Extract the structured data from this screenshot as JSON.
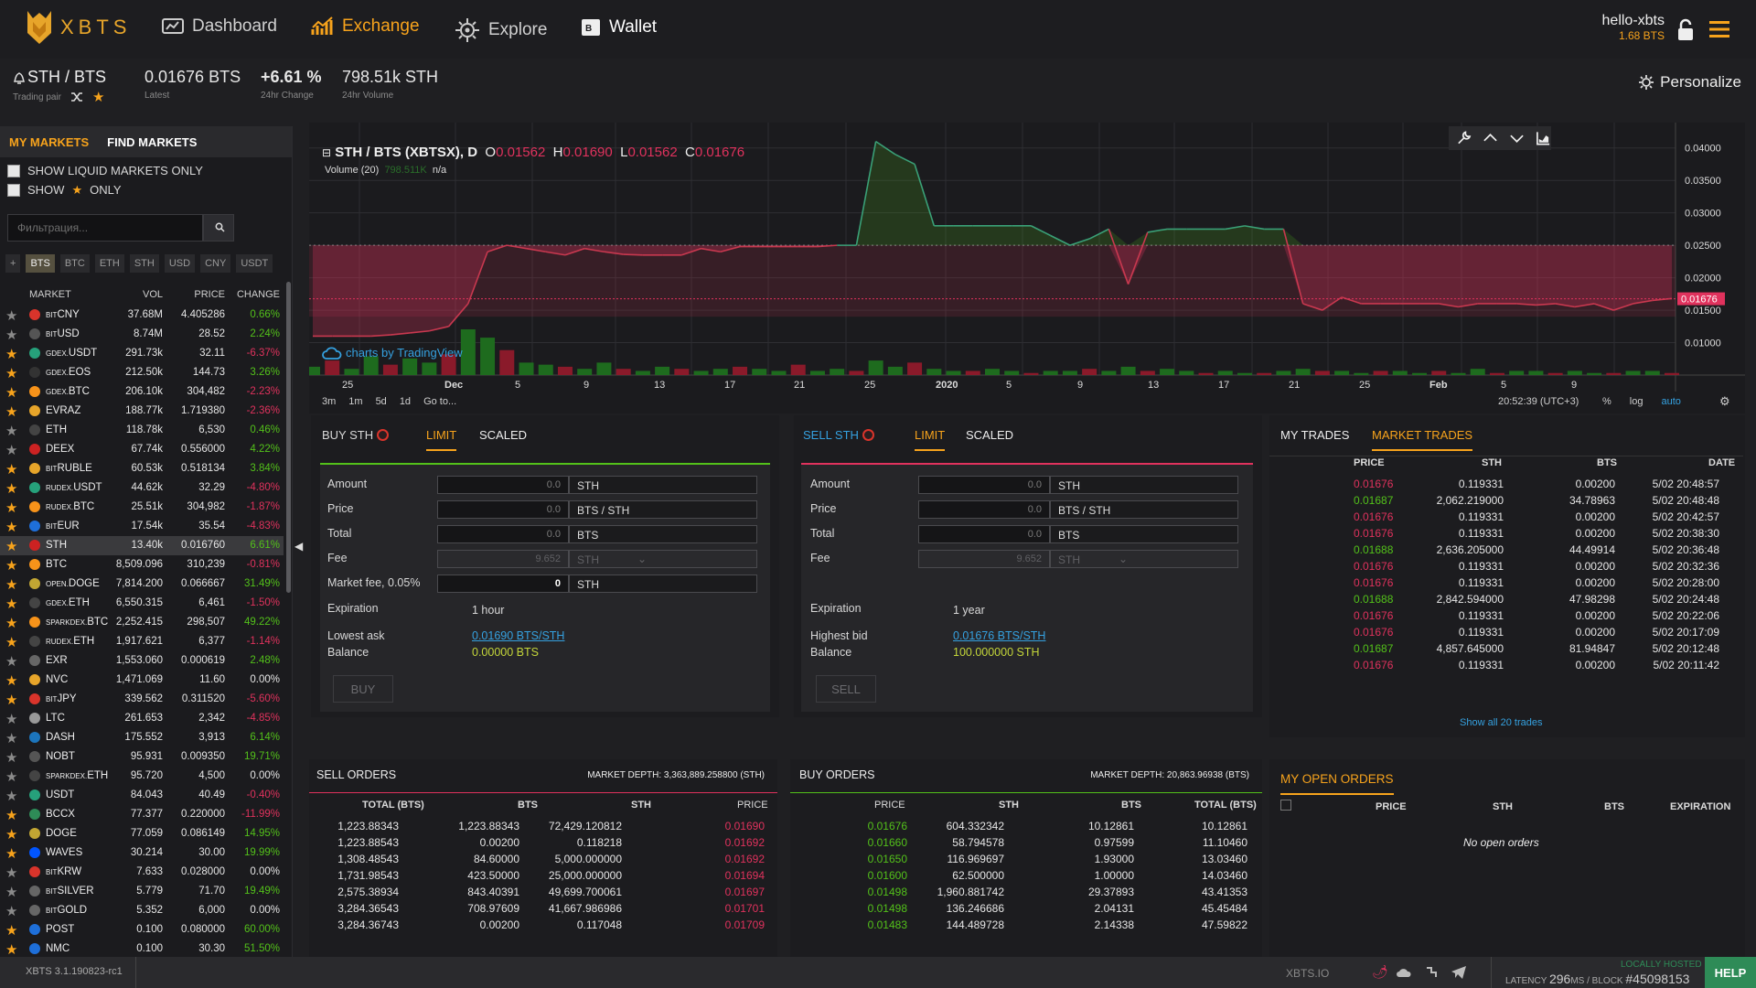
{
  "app": {
    "brand": "XBTS",
    "nav": [
      {
        "label": "Dashboard",
        "icon": "dashboard-icon"
      },
      {
        "label": "Exchange",
        "icon": "exchange-chart-icon"
      },
      {
        "label": "Explore",
        "icon": "explore-gear-icon"
      },
      {
        "label": "Wallet",
        "icon": "wallet-icon"
      }
    ],
    "user": {
      "name": "hello-xbts",
      "balance": "1.68 BTS"
    }
  },
  "pair": {
    "name": "STH / BTS",
    "caption": "Trading pair",
    "latest": "0.01676 BTS",
    "latest_label": "Latest",
    "change": "+6.61 %",
    "change_label": "24hr Change",
    "volume": "798.51k STH",
    "volume_label": "24hr Volume",
    "personalize": "Personalize"
  },
  "sidebar": {
    "tab_my": "MY MARKETS",
    "tab_find": "FIND MARKETS",
    "opt_liquid": "SHOW LIQUID MARKETS ONLY",
    "opt_star_pre": "SHOW",
    "opt_star_post": "ONLY",
    "filter_placeholder": "Фильтрация...",
    "quote_tabs": [
      "+",
      "BTS",
      "BTC",
      "ETH",
      "STH",
      "USD",
      "CNY",
      "USDT"
    ],
    "headers": {
      "market": "MARKET",
      "vol": "VOL",
      "price": "PRICE",
      "change": "CHANGE"
    },
    "markets": [
      {
        "pre": "BIT",
        "name": "CNY",
        "vol": "37.68M",
        "price": "4.405286",
        "change": "0.66%",
        "dir": "up",
        "color": "#d9342b"
      },
      {
        "pre": "BIT",
        "name": "USD",
        "vol": "8.74M",
        "price": "28.52",
        "change": "2.24%",
        "dir": "up",
        "color": "#555"
      },
      {
        "pre": "GDEX.",
        "name": "USDT",
        "vol": "291.73k",
        "price": "32.11",
        "change": "-6.37%",
        "dir": "down",
        "color": "#26a17b"
      },
      {
        "pre": "GDEX.",
        "name": "EOS",
        "vol": "212.50k",
        "price": "144.73",
        "change": "3.26%",
        "dir": "up",
        "color": "#333"
      },
      {
        "pre": "GDEX.",
        "name": "BTC",
        "vol": "206.10k",
        "price": "304,482",
        "change": "-2.23%",
        "dir": "down",
        "color": "#f7931a"
      },
      {
        "pre": "",
        "name": "EVRAZ",
        "vol": "188.77k",
        "price": "1.719380",
        "change": "-2.36%",
        "dir": "down",
        "color": "#e7a52a"
      },
      {
        "pre": "",
        "name": "ETH",
        "vol": "118.78k",
        "price": "6,530",
        "change": "0.46%",
        "dir": "up",
        "color": "#444"
      },
      {
        "pre": "",
        "name": "DEEX",
        "vol": "67.74k",
        "price": "0.556000",
        "change": "4.22%",
        "dir": "up",
        "color": "#c22"
      },
      {
        "pre": "BIT",
        "name": "RUBLE",
        "vol": "60.53k",
        "price": "0.518134",
        "change": "3.84%",
        "dir": "up",
        "color": "#e7a52a"
      },
      {
        "pre": "RUDEX.",
        "name": "USDT",
        "vol": "44.62k",
        "price": "32.29",
        "change": "-4.80%",
        "dir": "down",
        "color": "#26a17b"
      },
      {
        "pre": "RUDEX.",
        "name": "BTC",
        "vol": "25.51k",
        "price": "304,982",
        "change": "-1.87%",
        "dir": "down",
        "color": "#f7931a"
      },
      {
        "pre": "BIT",
        "name": "EUR",
        "vol": "17.54k",
        "price": "35.54",
        "change": "-4.83%",
        "dir": "down",
        "color": "#1e6fd9"
      },
      {
        "pre": "",
        "name": "STH",
        "vol": "13.40k",
        "price": "0.016760",
        "change": "6.61%",
        "dir": "up",
        "color": "#c22",
        "selected": true
      },
      {
        "pre": "",
        "name": "BTC",
        "vol": "8,509.096",
        "price": "310,239",
        "change": "-0.81%",
        "dir": "down",
        "color": "#f7931a"
      },
      {
        "pre": "OPEN.",
        "name": "DOGE",
        "vol": "7,814.200",
        "price": "0.066667",
        "change": "31.49%",
        "dir": "up",
        "color": "#c2a633"
      },
      {
        "pre": "GDEX.",
        "name": "ETH",
        "vol": "6,550.315",
        "price": "6,461",
        "change": "-1.50%",
        "dir": "down",
        "color": "#444"
      },
      {
        "pre": "SPARKDEX.",
        "name": "BTC",
        "vol": "2,252.415",
        "price": "298,507",
        "change": "49.22%",
        "dir": "up",
        "color": "#f7931a"
      },
      {
        "pre": "RUDEX.",
        "name": "ETH",
        "vol": "1,917.621",
        "price": "6,377",
        "change": "-1.14%",
        "dir": "down",
        "color": "#444"
      },
      {
        "pre": "",
        "name": "EXR",
        "vol": "1,553.060",
        "price": "0.000619",
        "change": "2.48%",
        "dir": "up",
        "color": "#666"
      },
      {
        "pre": "",
        "name": "NVC",
        "vol": "1,471.069",
        "price": "11.60",
        "change": "0.00%",
        "dir": "flat",
        "color": "#e7a52a"
      },
      {
        "pre": "BIT",
        "name": "JPY",
        "vol": "339.562",
        "price": "0.311520",
        "change": "-5.60%",
        "dir": "down",
        "color": "#d9342b"
      },
      {
        "pre": "",
        "name": "LTC",
        "vol": "261.653",
        "price": "2,342",
        "change": "-4.85%",
        "dir": "down",
        "color": "#999"
      },
      {
        "pre": "",
        "name": "DASH",
        "vol": "175.552",
        "price": "3,913",
        "change": "6.14%",
        "dir": "up",
        "color": "#1c75bc"
      },
      {
        "pre": "",
        "name": "NOBT",
        "vol": "95.931",
        "price": "0.009350",
        "change": "19.71%",
        "dir": "up",
        "color": "#555"
      },
      {
        "pre": "SPARKDEX.",
        "name": "ETH",
        "vol": "95.720",
        "price": "4,500",
        "change": "0.00%",
        "dir": "flat",
        "color": "#444"
      },
      {
        "pre": "",
        "name": "USDT",
        "vol": "84.043",
        "price": "40.49",
        "change": "-0.40%",
        "dir": "down",
        "color": "#26a17b"
      },
      {
        "pre": "",
        "name": "BCCX",
        "vol": "77.377",
        "price": "0.220000",
        "change": "-11.99%",
        "dir": "down",
        "color": "#2e8b57"
      },
      {
        "pre": "",
        "name": "DOGE",
        "vol": "77.059",
        "price": "0.086149",
        "change": "14.95%",
        "dir": "up",
        "color": "#c2a633"
      },
      {
        "pre": "",
        "name": "WAVES",
        "vol": "30.214",
        "price": "30.00",
        "change": "19.99%",
        "dir": "up",
        "color": "#0155ff"
      },
      {
        "pre": "BIT",
        "name": "KRW",
        "vol": "7.633",
        "price": "0.028000",
        "change": "0.00%",
        "dir": "flat",
        "color": "#d9342b"
      },
      {
        "pre": "BIT",
        "name": "SILVER",
        "vol": "5.779",
        "price": "71.70",
        "change": "19.49%",
        "dir": "up",
        "color": "#666"
      },
      {
        "pre": "BIT",
        "name": "GOLD",
        "vol": "5.352",
        "price": "6,000",
        "change": "0.00%",
        "dir": "flat",
        "color": "#666"
      },
      {
        "pre": "",
        "name": "POST",
        "vol": "0.100",
        "price": "0.080000",
        "change": "60.00%",
        "dir": "up",
        "color": "#1e6fd9"
      },
      {
        "pre": "",
        "name": "NMC",
        "vol": "0.100",
        "price": "30.30",
        "change": "51.50%",
        "dir": "up",
        "color": "#1e6fd9"
      }
    ]
  },
  "chart": {
    "symbol": "STH / BTS (XBTSX), D",
    "open_label": "O",
    "open": "0.01562",
    "high_label": "H",
    "high": "0.01690",
    "low_label": "L",
    "low": "0.01562",
    "close_label": "C",
    "close": "0.01676",
    "volume_label": "Volume (20)",
    "volume_value": "798.511K",
    "volume_na": "n/a",
    "credit": "charts by TradingView",
    "current_price_tag": "0.01676",
    "y_ticks": [
      "0.04000",
      "0.03500",
      "0.03000",
      "0.02500",
      "0.02000",
      "0.01500",
      "0.01000"
    ],
    "x_ticks": [
      "25",
      "Dec",
      "5",
      "9",
      "13",
      "17",
      "21",
      "25",
      "2020",
      "5",
      "9",
      "13",
      "17",
      "21",
      "25",
      "Feb",
      "5",
      "9"
    ],
    "ranges": [
      "3m",
      "1m",
      "5d",
      "1d",
      "Go to..."
    ],
    "clock": "20:52:39 (UTC+3)",
    "opts": [
      "%",
      "log",
      "auto"
    ],
    "series_price": [
      0.011,
      0.011,
      0.011,
      0.011,
      0.0112,
      0.0115,
      0.0118,
      0.0125,
      0.016,
      0.024,
      0.025,
      0.0245,
      0.024,
      0.0235,
      0.0245,
      0.024,
      0.0236,
      0.0235,
      0.0235,
      0.0235,
      0.0245,
      0.024,
      0.0248,
      0.0248,
      0.0248,
      0.0248,
      0.0248,
      0.025,
      0.025,
      0.041,
      0.039,
      0.0375,
      0.028,
      0.028,
      0.028,
      0.028,
      0.028,
      0.028,
      0.0265,
      0.025,
      0.026,
      0.0275,
      0.019,
      0.027,
      0.0275,
      0.0275,
      0.0275,
      0.0275,
      0.028,
      0.0275,
      0.0275,
      0.016,
      0.015,
      0.017,
      0.016,
      0.016,
      0.016,
      0.016,
      0.016,
      0.0155,
      0.016,
      0.016,
      0.016,
      0.0158,
      0.016,
      0.0155,
      0.016,
      0.015,
      0.016,
      0.0165,
      0.0168
    ],
    "volume_bars": [
      4,
      7,
      3,
      9,
      5,
      8,
      6,
      10,
      22,
      18,
      12,
      6,
      5,
      4,
      3,
      6,
      3,
      2,
      4,
      3,
      2,
      3,
      4,
      3,
      2,
      5,
      2,
      3,
      2,
      7,
      4,
      6,
      3,
      2,
      2,
      3,
      2,
      1,
      2,
      2,
      3,
      2,
      4,
      2,
      3,
      2,
      1,
      2,
      1,
      1,
      2,
      3,
      2,
      2,
      1,
      2,
      2,
      1,
      2,
      1,
      3,
      1,
      2,
      2,
      1,
      2,
      1,
      1,
      2,
      2,
      1
    ]
  },
  "buy": {
    "title": "BUY STH",
    "tab_limit": "LIMIT",
    "tab_scaled": "SCALED",
    "amount_label": "Amount",
    "amount": "0.0",
    "amount_unit": "STH",
    "price_label": "Price",
    "price": "0.0",
    "price_unit": "BTS / STH",
    "total_label": "Total",
    "total": "0.0",
    "total_unit": "BTS",
    "fee_label": "Fee",
    "fee": "9.652",
    "fee_unit": "STH",
    "mfee_label": "Market fee, 0.05%",
    "mfee": "0",
    "mfee_unit": "STH",
    "exp_label": "Expiration",
    "exp": "1 hour",
    "best_label": "Lowest ask",
    "best": "0.01690 BTS/STH",
    "bal_label": "Balance",
    "bal": "0.00000 BTS",
    "button": "BUY"
  },
  "sell": {
    "title": "SELL STH",
    "tab_limit": "LIMIT",
    "tab_scaled": "SCALED",
    "amount_label": "Amount",
    "amount": "0.0",
    "amount_unit": "STH",
    "price_label": "Price",
    "price": "0.0",
    "price_unit": "BTS / STH",
    "total_label": "Total",
    "total": "0.0",
    "total_unit": "BTS",
    "fee_label": "Fee",
    "fee": "9.652",
    "fee_unit": "STH",
    "exp_label": "Expiration",
    "exp": "1 year",
    "best_label": "Highest bid",
    "best": "0.01676 BTS/STH",
    "bal_label": "Balance",
    "bal": "100.000000 STH",
    "button": "SELL"
  },
  "trades": {
    "tab_my": "MY TRADES",
    "tab_market": "MARKET TRADES",
    "headers": [
      "PRICE",
      "STH",
      "BTS",
      "DATE"
    ],
    "rows": [
      {
        "price": "0.01676",
        "sth": "0.119331",
        "bts": "0.00200",
        "date": "5/02 20:48:57",
        "side": "sell"
      },
      {
        "price": "0.01687",
        "sth": "2,062.219000",
        "bts": "34.78963",
        "date": "5/02 20:48:48",
        "side": "buy"
      },
      {
        "price": "0.01676",
        "sth": "0.119331",
        "bts": "0.00200",
        "date": "5/02 20:42:57",
        "side": "sell"
      },
      {
        "price": "0.01676",
        "sth": "0.119331",
        "bts": "0.00200",
        "date": "5/02 20:38:30",
        "side": "sell"
      },
      {
        "price": "0.01688",
        "sth": "2,636.205000",
        "bts": "44.49914",
        "date": "5/02 20:36:48",
        "side": "buy"
      },
      {
        "price": "0.01676",
        "sth": "0.119331",
        "bts": "0.00200",
        "date": "5/02 20:32:36",
        "side": "sell"
      },
      {
        "price": "0.01676",
        "sth": "0.119331",
        "bts": "0.00200",
        "date": "5/02 20:28:00",
        "side": "sell"
      },
      {
        "price": "0.01688",
        "sth": "2,842.594000",
        "bts": "47.98298",
        "date": "5/02 20:24:48",
        "side": "buy"
      },
      {
        "price": "0.01676",
        "sth": "0.119331",
        "bts": "0.00200",
        "date": "5/02 20:22:06",
        "side": "sell"
      },
      {
        "price": "0.01676",
        "sth": "0.119331",
        "bts": "0.00200",
        "date": "5/02 20:17:09",
        "side": "sell"
      },
      {
        "price": "0.01687",
        "sth": "4,857.645000",
        "bts": "81.94847",
        "date": "5/02 20:12:48",
        "side": "buy"
      },
      {
        "price": "0.01676",
        "sth": "0.119331",
        "bts": "0.00200",
        "date": "5/02 20:11:42",
        "side": "sell"
      }
    ],
    "show_all": "Show all 20 trades"
  },
  "sell_orders": {
    "title": "SELL ORDERS",
    "depth": "MARKET DEPTH: 3,363,889.258800 (STH)",
    "headers": [
      "TOTAL (BTS)",
      "BTS",
      "STH",
      "PRICE"
    ],
    "rows": [
      [
        "1,223.88343",
        "1,223.88343",
        "72,429.120812",
        "0.01690"
      ],
      [
        "1,223.88543",
        "0.00200",
        "0.118218",
        "0.01692"
      ],
      [
        "1,308.48543",
        "84.60000",
        "5,000.000000",
        "0.01692"
      ],
      [
        "1,731.98543",
        "423.50000",
        "25,000.000000",
        "0.01694"
      ],
      [
        "2,575.38934",
        "843.40391",
        "49,699.700061",
        "0.01697"
      ],
      [
        "3,284.36543",
        "708.97609",
        "41,667.986986",
        "0.01701"
      ],
      [
        "3,284.36743",
        "0.00200",
        "0.117048",
        "0.01709"
      ]
    ]
  },
  "buy_orders": {
    "title": "BUY ORDERS",
    "depth": "MARKET DEPTH: 20,863.96938 (BTS)",
    "headers": [
      "PRICE",
      "STH",
      "BTS",
      "TOTAL (BTS)"
    ],
    "rows": [
      [
        "0.01676",
        "604.332342",
        "10.12861",
        "10.12861"
      ],
      [
        "0.01660",
        "58.794578",
        "0.97599",
        "11.10460"
      ],
      [
        "0.01650",
        "116.969697",
        "1.93000",
        "13.03460"
      ],
      [
        "0.01600",
        "62.500000",
        "1.00000",
        "14.03460"
      ],
      [
        "0.01498",
        "1,960.881742",
        "29.37893",
        "43.41353"
      ],
      [
        "0.01498",
        "136.246686",
        "2.04131",
        "45.45484"
      ],
      [
        "0.01483",
        "144.489728",
        "2.14338",
        "47.59822"
      ]
    ]
  },
  "open_orders": {
    "title": "MY OPEN ORDERS",
    "headers": [
      "PRICE",
      "STH",
      "BTS",
      "EXPIRATION"
    ],
    "empty": "No open orders"
  },
  "footer": {
    "version": "XBTS 3.1.190823-rc1",
    "site": "XBTS.IO",
    "hosted": "LOCALLY HOSTED",
    "latency_label": "LATENCY",
    "latency": "296",
    "latency_unit": "MS",
    "block_label": "/ BLOCK",
    "block": "#45098153",
    "help": "HELP"
  },
  "colors": {
    "accent": "#f7a31c",
    "up": "#53c11a",
    "down": "#e0325d",
    "link": "#35a1e0"
  }
}
